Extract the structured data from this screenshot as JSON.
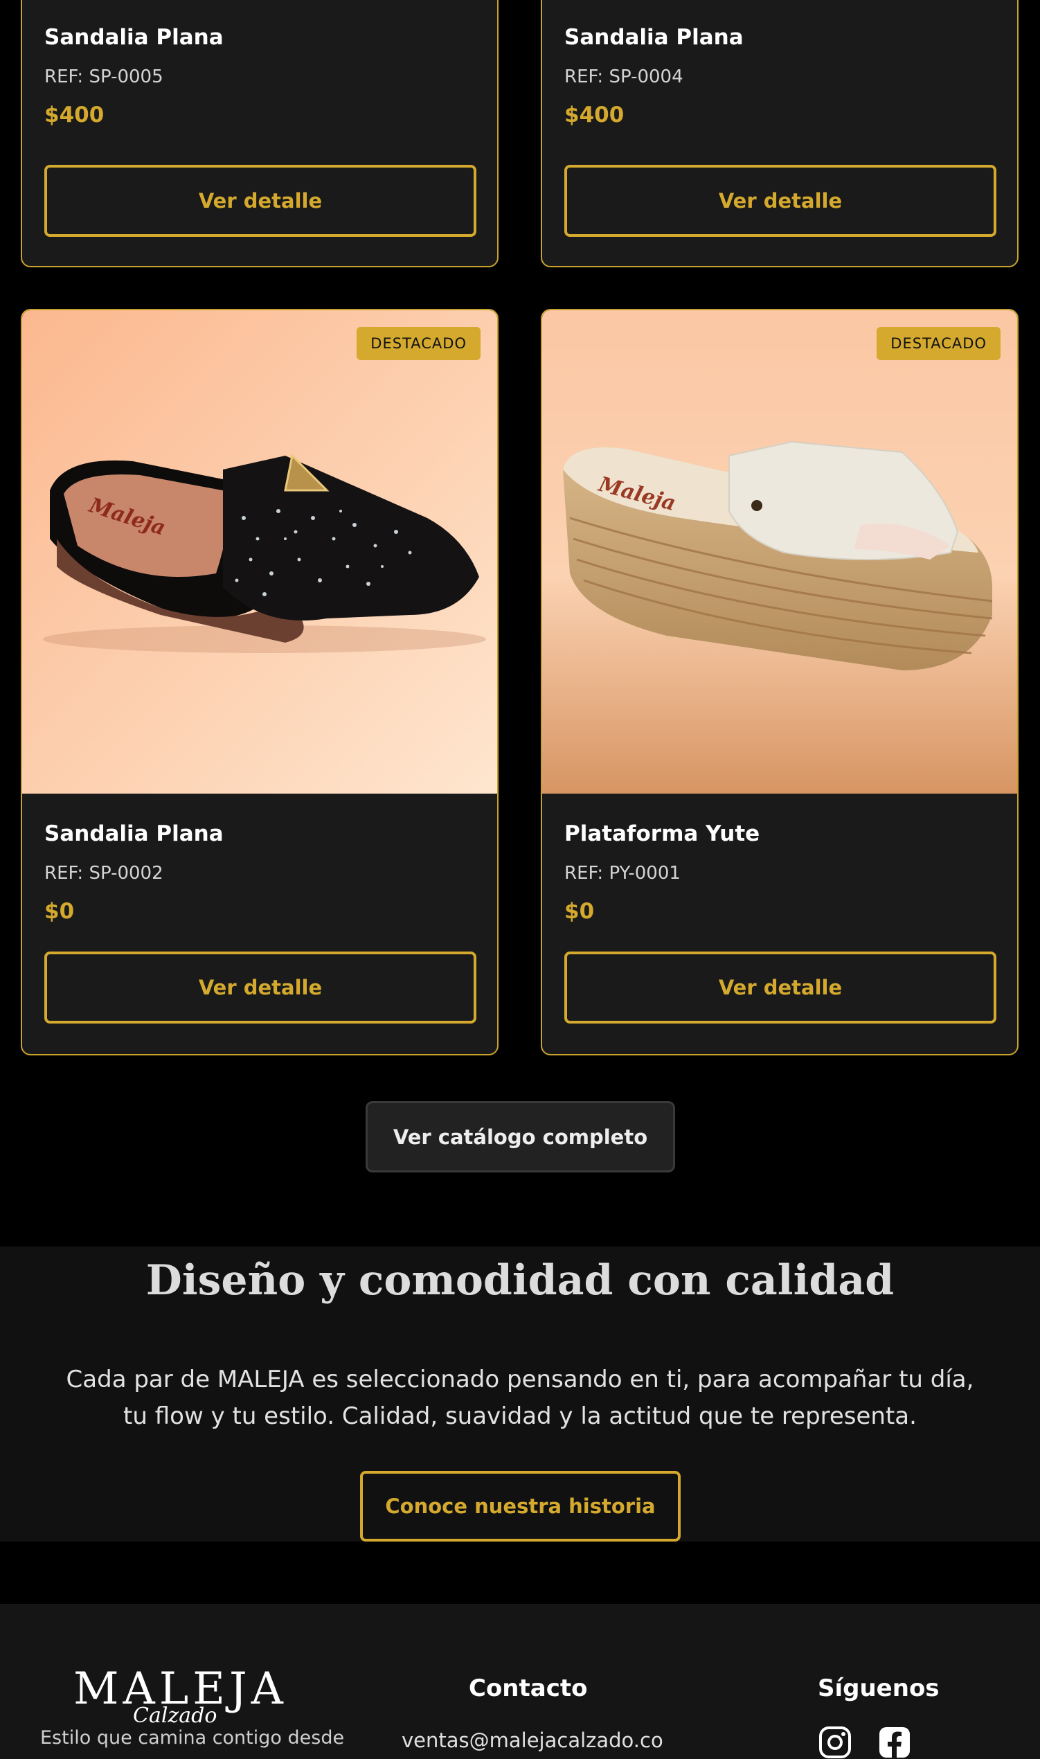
{
  "products": [
    {
      "title": "Sandalia Plana",
      "ref": "REF: SP-0005",
      "price": "$400",
      "button": "Ver detalle"
    },
    {
      "title": "Sandalia Plana",
      "ref": "REF: SP-0004",
      "price": "$400",
      "button": "Ver detalle"
    },
    {
      "title": "Sandalia Plana",
      "ref": "REF: SP-0002",
      "price": "$0",
      "button": "Ver detalle",
      "badge": "DESTACADO",
      "image": "black-rhinestone-slide-sandal"
    },
    {
      "title": "Plataforma Yute",
      "ref": "REF: PY-0001",
      "price": "$0",
      "button": "Ver detalle",
      "badge": "DESTACADO",
      "image": "white-jute-platform-sandal"
    }
  ],
  "catalog_button": "Ver catálogo completo",
  "about": {
    "title": "Diseño y comodidad con calidad",
    "text": "Cada par de MALEJA es seleccionado pensando en ti, para acompañar tu día, tu flow y tu estilo. Calidad, suavidad y la actitud que te representa.",
    "button": "Conoce nuestra historia"
  },
  "footer": {
    "logo": "MALEJA",
    "logo_sub": "Calzado",
    "tagline": "Estilo que camina contigo desde",
    "contact_heading": "Contacto",
    "email": "ventas@malejacalzado.co",
    "social_heading": "Síguenos",
    "social_icons": [
      "instagram-icon",
      "facebook-icon"
    ]
  },
  "colors": {
    "accent": "#d4a92e",
    "card_bg": "#1a1a1a",
    "page_bg": "#000000"
  }
}
